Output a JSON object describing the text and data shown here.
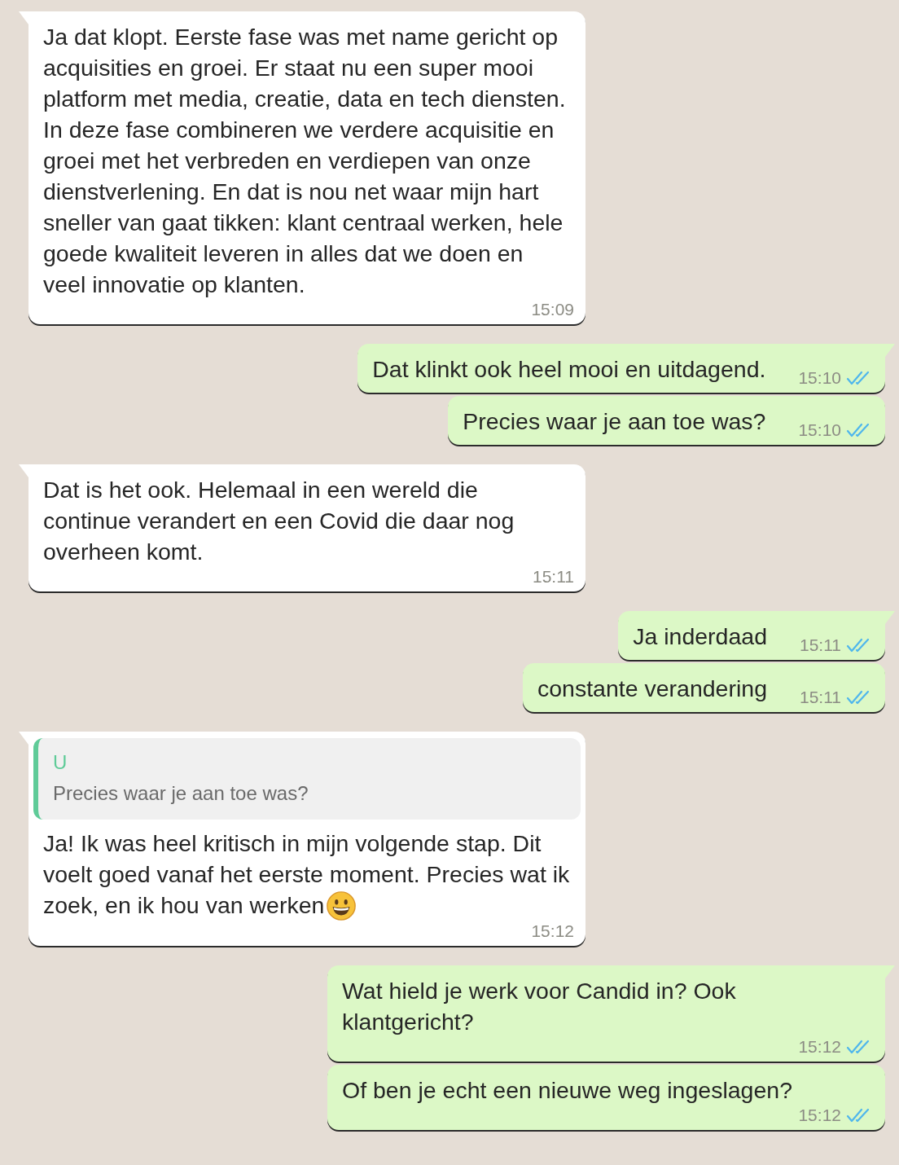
{
  "messages": [
    {
      "kind": "incoming",
      "tail": true,
      "text": "Ja dat klopt. Eerste fase was met name gericht op acquisities en groei. Er staat nu een super mooi platform met media, creatie, data en tech diensten. In deze fase combineren we verdere acquisitie en groei met het verbreden en verdiepen van onze dienstverlening. En dat is nou net waar mijn hart sneller van gaat tikken: klant centraal werken, hele goede kwaliteit leveren in alles dat we doen en veel innovatie op klanten.",
      "time": "15:09"
    },
    {
      "kind": "outgoing",
      "tail": true,
      "text": "Dat klinkt ook heel mooi en uitdagend.",
      "time": "15:10",
      "read": true
    },
    {
      "kind": "outgoing",
      "tail": false,
      "text": "Precies waar je aan toe was?",
      "time": "15:10",
      "read": true
    },
    {
      "kind": "incoming",
      "tail": true,
      "text": "Dat is het ook. Helemaal in een wereld die continue verandert en een Covid die daar nog overheen komt.",
      "time": "15:11"
    },
    {
      "kind": "outgoing",
      "tail": true,
      "text": "Ja inderdaad",
      "time": "15:11",
      "read": true
    },
    {
      "kind": "outgoing",
      "tail": false,
      "text": "constante verandering",
      "time": "15:11",
      "read": true
    },
    {
      "kind": "incoming",
      "tail": true,
      "quote": {
        "author": "U",
        "text": "Precies waar je aan toe was?"
      },
      "text": "Ja! Ik was heel kritisch in mijn volgende stap. Dit voelt goed vanaf het eerste moment. Precies wat ik zoek, en ik hou van werken",
      "emoji": true,
      "time": "15:12"
    },
    {
      "kind": "outgoing",
      "tail": true,
      "text": "Wat hield je werk voor Candid in? Ook klantgericht?",
      "time": "15:12",
      "read": true
    },
    {
      "kind": "outgoing",
      "tail": false,
      "text": "Of ben je echt een nieuwe weg ingeslagen?",
      "time": "15:12",
      "read": true
    }
  ]
}
